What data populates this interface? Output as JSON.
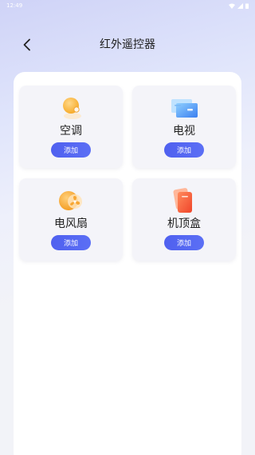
{
  "status_bar": {
    "time": "12:49"
  },
  "header": {
    "title": "红外遥控器"
  },
  "devices": [
    {
      "label": "空调",
      "button": "添加",
      "icon": "air-conditioner-icon"
    },
    {
      "label": "电视",
      "button": "添加",
      "icon": "tv-icon"
    },
    {
      "label": "电风扇",
      "button": "添加",
      "icon": "fan-icon"
    },
    {
      "label": "机顶盒",
      "button": "添加",
      "icon": "set-top-box-icon"
    }
  ],
  "colors": {
    "accent": "#5366f2",
    "card_bg": "#f4f4f9",
    "panel_bg": "#ffffff"
  }
}
